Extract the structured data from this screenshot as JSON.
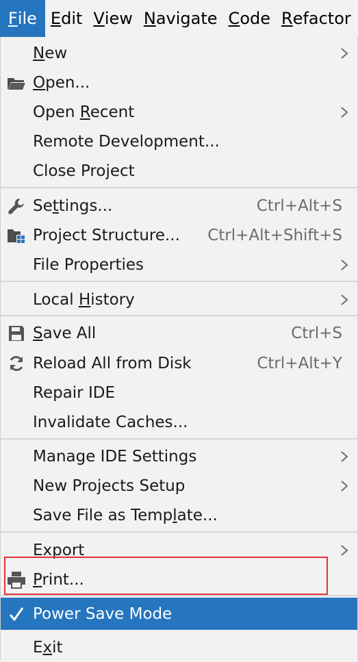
{
  "menubar": [
    {
      "pre": "",
      "mn": "F",
      "post": "ile"
    },
    {
      "pre": "",
      "mn": "E",
      "post": "dit"
    },
    {
      "pre": "",
      "mn": "V",
      "post": "iew"
    },
    {
      "pre": "",
      "mn": "N",
      "post": "avigate"
    },
    {
      "pre": "",
      "mn": "C",
      "post": "ode"
    },
    {
      "pre": "",
      "mn": "R",
      "post": "efactor"
    }
  ],
  "items": {
    "new": {
      "pre": "",
      "mn": "N",
      "post": "ew"
    },
    "open": {
      "pre": "",
      "mn": "O",
      "post": "pen..."
    },
    "open_recent": {
      "pre": "Open ",
      "mn": "R",
      "post": "ecent"
    },
    "remote_development": {
      "pre": "Remote Development...",
      "mn": "",
      "post": ""
    },
    "close_project": {
      "pre": "Close Project",
      "mn": "",
      "post": ""
    },
    "settings": {
      "pre": "Se",
      "mn": "t",
      "post": "tings...",
      "shortcut": "Ctrl+Alt+S"
    },
    "project_structure": {
      "pre": "Project Structure...",
      "mn": "",
      "post": "",
      "shortcut": "Ctrl+Alt+Shift+S"
    },
    "file_properties": {
      "pre": "File Properties",
      "mn": "",
      "post": ""
    },
    "local_history": {
      "pre": "Local ",
      "mn": "H",
      "post": "istory"
    },
    "save_all": {
      "pre": "",
      "mn": "S",
      "post": "ave All",
      "shortcut": "Ctrl+S"
    },
    "reload_all": {
      "pre": "Reload All from Disk",
      "mn": "",
      "post": "",
      "shortcut": "Ctrl+Alt+Y"
    },
    "repair_ide": {
      "pre": "Repair IDE",
      "mn": "",
      "post": ""
    },
    "invalidate_caches": {
      "pre": "Invalidate Caches...",
      "mn": "",
      "post": ""
    },
    "manage_ide_settings": {
      "pre": "Manage IDE Settings",
      "mn": "",
      "post": ""
    },
    "new_projects_setup": {
      "pre": "New Projects Setup",
      "mn": "",
      "post": ""
    },
    "save_file_as_template": {
      "pre": "Save File as Temp",
      "mn": "l",
      "post": "ate..."
    },
    "export": {
      "pre": "Export",
      "mn": "",
      "post": ""
    },
    "print": {
      "pre": "",
      "mn": "P",
      "post": "rint..."
    },
    "power_save_mode": {
      "pre": "Power Save Mode",
      "mn": "",
      "post": ""
    },
    "exit": {
      "pre": "E",
      "mn": "x",
      "post": "it"
    }
  },
  "colors": {
    "accent": "#2675bf",
    "highlight_border": "#e0323c",
    "background": "#f2f2f2"
  },
  "icons": {
    "open": "folder-icon",
    "settings": "wrench-icon",
    "project_structure": "project-structure-icon",
    "save_all": "save-icon",
    "reload_all": "reload-icon",
    "print": "printer-icon",
    "power_save_mode": "checkmark-icon",
    "submenu": "chevron-right-icon"
  }
}
